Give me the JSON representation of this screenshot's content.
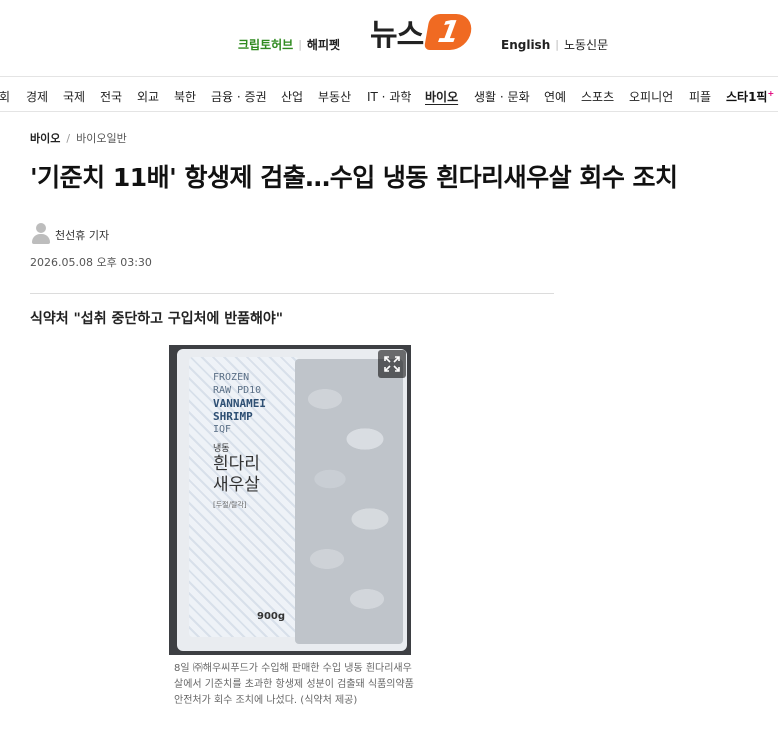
{
  "header": {
    "left_links": [
      "크립토허브",
      "해피펫"
    ],
    "logo_text": "뉴스",
    "logo_badge": "1",
    "right_links": [
      "English",
      "노동신문"
    ],
    "accent_green": "#2f8a1f",
    "logo_orange": "#f06a22"
  },
  "nav": {
    "items": [
      "회",
      "경제",
      "국제",
      "전국",
      "외교",
      "북한",
      "금융 · 증권",
      "산업",
      "부동산",
      "IT · 과학",
      "바이오",
      "생활 · 문화",
      "연예",
      "스포츠",
      "오피니언",
      "피플",
      "스타1픽"
    ],
    "active": "바이오",
    "star_mark": "+"
  },
  "breadcrumb": {
    "current": "바이오",
    "separator": "/",
    "sub": "바이오일반"
  },
  "article": {
    "headline": "'기준치 11배' 항생제 검출…수입 냉동 흰다리새우살 회수 조치",
    "reporter": "천선휴 기자",
    "datetime": "2026.05.08 오후 03:30",
    "subtitle": "식약처 \"섭취 중단하고 구입처에 반품해야\"",
    "caption": "8일 ㈜해우씨푸드가 수입해 판매한 수입 냉동 흰다리새우살에서 기준치를 초과한 항생제 성분이 검출돼 식품의약품안전처가 회수 조치에 나섰다. (식약처 제공)"
  },
  "photo": {
    "package_en": [
      "FROZEN",
      "RAW PD10",
      "VANNAMEI",
      "SHRIMP",
      "IQF"
    ],
    "package_ko_small": "냉동",
    "package_ko_big": [
      "흰다리",
      "새우살"
    ],
    "package_ko_tiny": "[두절/탈각]",
    "package_weight": "900g",
    "expand_icon": "expand-icon"
  }
}
